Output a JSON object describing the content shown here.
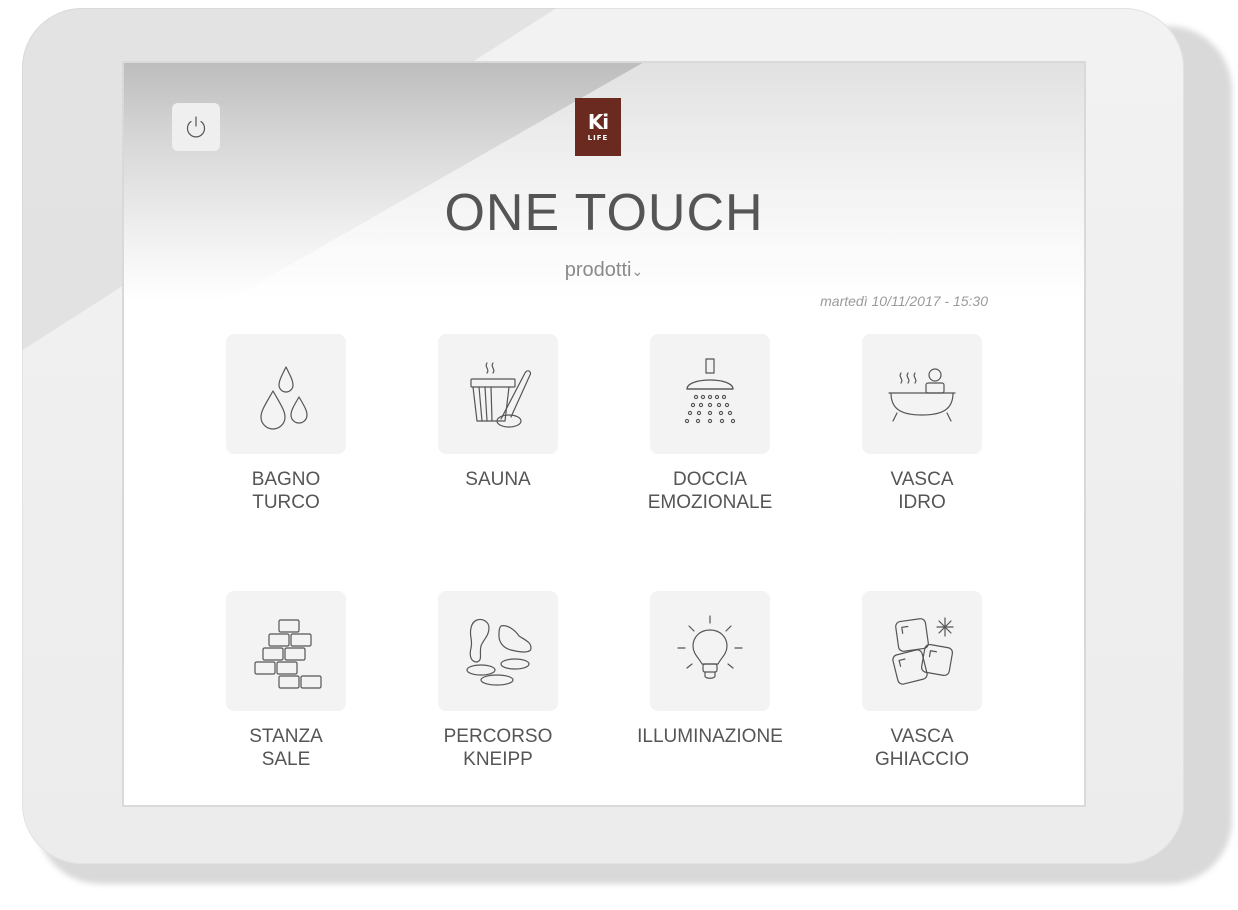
{
  "brand": {
    "logo_main": "Ki",
    "logo_sub": "LIFE"
  },
  "header": {
    "title": "ONE TOUCH",
    "subtitle": "prodotti",
    "subtitle_caret": "⌄",
    "datetime": "martedì 10/11/2017 - 15:30"
  },
  "power": {
    "icon": "power-icon"
  },
  "tiles": [
    {
      "icon": "water-drops-icon",
      "line1": "BAGNO",
      "line2": "TURCO"
    },
    {
      "icon": "sauna-bucket-icon",
      "line1": "SAUNA",
      "line2": ""
    },
    {
      "icon": "shower-icon",
      "line1": "DOCCIA",
      "line2": "EMOZIONALE"
    },
    {
      "icon": "hot-tub-icon",
      "line1": "VASCA",
      "line2": "IDRO"
    },
    {
      "icon": "salt-bricks-icon",
      "line1": "STANZA",
      "line2": "SALE"
    },
    {
      "icon": "feet-stones-icon",
      "line1": "PERCORSO",
      "line2": "KNEIPP"
    },
    {
      "icon": "light-bulb-icon",
      "line1": "ILLUMINAZIONE",
      "line2": ""
    },
    {
      "icon": "ice-cubes-icon",
      "line1": "VASCA",
      "line2": "GHIACCIO"
    }
  ],
  "colors": {
    "brand": "#6b2a1f",
    "text": "#555555",
    "tile_bg": "#f3f3f3"
  }
}
